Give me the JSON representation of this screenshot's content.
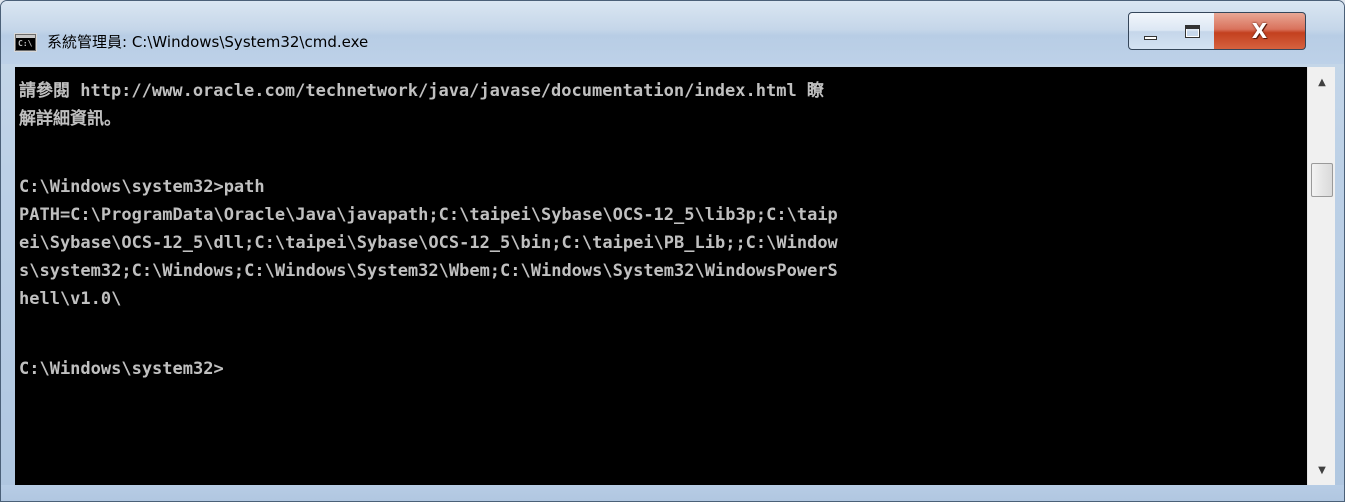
{
  "window": {
    "title": "系統管理員: C:\\Windows\\System32\\cmd.exe",
    "icon_text": "C:\\",
    "controls": {
      "minimize": "minimize",
      "maximize": "maximize",
      "close": "X"
    }
  },
  "console": {
    "lines": [
      "請參閱 http://www.oracle.com/technetwork/java/javase/documentation/index.html 瞭",
      "解詳細資訊。",
      "",
      "C:\\Windows\\system32>path",
      "PATH=C:\\ProgramData\\Oracle\\Java\\javapath;C:\\taipei\\Sybase\\OCS-12_5\\lib3p;C:\\taip",
      "ei\\Sybase\\OCS-12_5\\dll;C:\\taipei\\Sybase\\OCS-12_5\\bin;C:\\taipei\\PB_Lib;;C:\\Window",
      "s\\system32;C:\\Windows;C:\\Windows\\System32\\Wbem;C:\\Windows\\System32\\WindowsPowerS",
      "hell\\v1.0\\",
      "",
      "C:\\Windows\\system32>"
    ]
  },
  "scrollbar": {
    "up_arrow": "▲",
    "down_arrow": "▼"
  }
}
